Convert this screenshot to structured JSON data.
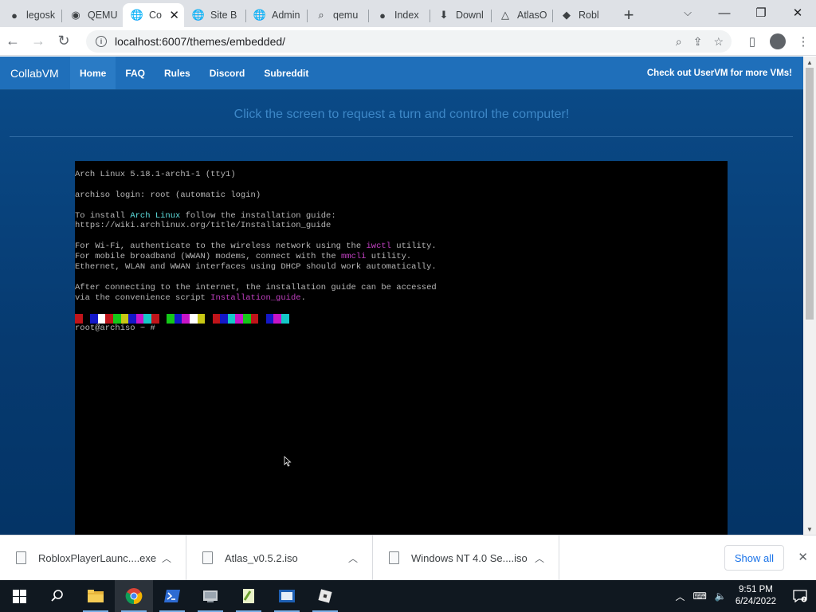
{
  "browser": {
    "tabs": [
      {
        "title": "legosk",
        "icon": "github-icon"
      },
      {
        "title": "QEMU",
        "icon": "qemu-icon"
      },
      {
        "title": "Co",
        "icon": "globe-icon",
        "active": true
      },
      {
        "title": "Site B",
        "icon": "globe-icon"
      },
      {
        "title": "Admin",
        "icon": "globe-icon"
      },
      {
        "title": "qemu",
        "icon": "search-icon"
      },
      {
        "title": "Index",
        "icon": "github-icon"
      },
      {
        "title": "Downl",
        "icon": "download-icon"
      },
      {
        "title": "AtlasO",
        "icon": "atlas-icon"
      },
      {
        "title": "Robl",
        "icon": "roblox-icon"
      }
    ],
    "url": "localhost:6007/themes/embedded/"
  },
  "site": {
    "brand": "CollabVM",
    "nav": [
      "Home",
      "FAQ",
      "Rules",
      "Discord",
      "Subreddit"
    ],
    "promo": "Check out UserVM for more VMs!",
    "prompt": "Click the screen to request a turn and control the computer!"
  },
  "terminal": {
    "lines": [
      {
        "segments": [
          {
            "t": "Arch Linux 5.18.1-arch1-1 (tty1)"
          }
        ]
      },
      {
        "segments": []
      },
      {
        "segments": [
          {
            "t": "archiso login: root (automatic login)"
          }
        ]
      },
      {
        "segments": []
      },
      {
        "segments": [
          {
            "t": "To install "
          },
          {
            "t": "Arch Linux",
            "c": "hl-cyan"
          },
          {
            "t": " follow the installation guide:"
          }
        ]
      },
      {
        "segments": [
          {
            "t": "https://wiki.archlinux.org/title/Installation_guide"
          }
        ]
      },
      {
        "segments": []
      },
      {
        "segments": [
          {
            "t": "For Wi-Fi, authenticate to the wireless network using the "
          },
          {
            "t": "iwctl",
            "c": "hl-mag"
          },
          {
            "t": " utility."
          }
        ]
      },
      {
        "segments": [
          {
            "t": "For mobile broadband (WWAN) modems, connect with the "
          },
          {
            "t": "mmcli",
            "c": "hl-mag"
          },
          {
            "t": " utility."
          }
        ]
      },
      {
        "segments": [
          {
            "t": "Ethernet, WLAN and WWAN interfaces using DHCP should work automatically."
          }
        ]
      },
      {
        "segments": []
      },
      {
        "segments": [
          {
            "t": "After connecting to the internet, the installation guide can be accessed"
          }
        ]
      },
      {
        "segments": [
          {
            "t": "via the convenience script "
          },
          {
            "t": "Installation_guide",
            "c": "hl-mag"
          },
          {
            "t": "."
          }
        ]
      },
      {
        "segments": []
      }
    ],
    "colorbar": [
      "#c0141a",
      "#000000",
      "#1418c8",
      "#ffffff",
      "#c0141a",
      "#14c818",
      "#c8c814",
      "#1418c8",
      "#c814c8",
      "#14c8c8",
      "#c0141a",
      "#000000",
      "#14c818",
      "#1418c8",
      "#c814c8",
      "#ffffff",
      "#c8c814",
      "#000000",
      "#c0141a",
      "#1418c8",
      "#14c8c8",
      "#c814c8",
      "#14c818",
      "#c0141a",
      "#000000",
      "#1418c8",
      "#c814c8",
      "#14c8c8"
    ],
    "prompt": "root@archiso ~ #"
  },
  "downloads": {
    "items": [
      {
        "name": "RobloxPlayerLaunc....exe"
      },
      {
        "name": "Atlas_v0.5.2.iso"
      },
      {
        "name": "Windows NT 4.0 Se....iso"
      }
    ],
    "show_all": "Show all"
  },
  "taskbar": {
    "time": "9:51 PM",
    "date": "6/24/2022",
    "apps": [
      "file-explorer-icon",
      "chrome-icon",
      "powershell-icon",
      "control-panel-icon",
      "notepad-plus-icon",
      "vm-icon",
      "app-icon"
    ]
  }
}
